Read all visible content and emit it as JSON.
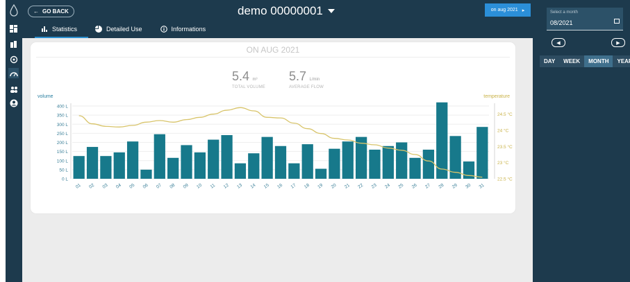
{
  "header": {
    "back_label": "GO BACK",
    "device_title": "demo 00000001",
    "date_pill": "on aug 2021"
  },
  "tabs": [
    {
      "label": "Statistics",
      "icon": "bar-chart-icon",
      "active": true
    },
    {
      "label": "Detailed Use",
      "icon": "pie-chart-icon",
      "active": false
    },
    {
      "label": "Informations",
      "icon": "info-icon",
      "active": false
    }
  ],
  "sidebar": {
    "icons": [
      "water-drop-logo",
      "dashboard-icon",
      "building-icon",
      "meter-icon",
      "gauge-icon",
      "users-icon",
      "account-icon"
    ]
  },
  "right_panel": {
    "month_label": "Select a month",
    "month_value": "08/2021",
    "periods": [
      "DAY",
      "WEEK",
      "MONTH",
      "YEAR"
    ],
    "active_period": "MONTH"
  },
  "card": {
    "title": "ON AUG 2021",
    "total_volume": {
      "value": "5.4",
      "unit": "m³",
      "label": "TOTAL VOLUME"
    },
    "average_flow": {
      "value": "5.7",
      "unit": "L/min",
      "label": "AVERAGE FLOW"
    }
  },
  "colors": {
    "sidebar": "#1d3a4d",
    "bar": "#17798b",
    "temperature_line": "#d8c46a",
    "accent": "#2b8fd9"
  },
  "chart_data": {
    "type": "bar",
    "categories": [
      "01",
      "02",
      "03",
      "04",
      "05",
      "06",
      "07",
      "08",
      "09",
      "10",
      "11",
      "12",
      "13",
      "14",
      "15",
      "16",
      "17",
      "18",
      "19",
      "20",
      "21",
      "22",
      "23",
      "24",
      "25",
      "26",
      "27",
      "28",
      "29",
      "30",
      "31"
    ],
    "series": [
      {
        "name": "volume",
        "type": "bar",
        "axis": "left",
        "unit": "L",
        "values": [
          125,
          175,
          125,
          145,
          205,
          50,
          245,
          115,
          185,
          145,
          215,
          240,
          85,
          140,
          230,
          180,
          85,
          190,
          55,
          165,
          205,
          230,
          160,
          180,
          200,
          115,
          160,
          420,
          235,
          95,
          285
        ]
      },
      {
        "name": "temperature",
        "type": "line",
        "axis": "right",
        "unit": "°C",
        "values": [
          24.45,
          24.2,
          24.12,
          24.1,
          24.15,
          24.25,
          24.3,
          24.25,
          24.33,
          24.4,
          24.5,
          24.62,
          24.7,
          24.6,
          24.4,
          24.38,
          24.22,
          24.05,
          23.9,
          23.75,
          23.7,
          23.6,
          23.55,
          23.45,
          23.38,
          23.25,
          23.05,
          22.8,
          22.7,
          22.6,
          22.55
        ]
      }
    ],
    "y_left": {
      "label": "volume",
      "ylim": [
        0,
        400
      ],
      "ticks": [
        "0 L",
        "50 L",
        "100 L",
        "150 L",
        "200 L",
        "250 L",
        "300 L",
        "350 L",
        "400 L"
      ]
    },
    "y_right": {
      "label": "temperature",
      "ylim": [
        22.5,
        24.75
      ],
      "ticks": [
        "22.5 °C",
        "23 °C",
        "23.5 °C",
        "24 °C",
        "24.5 °C"
      ]
    },
    "grid": true,
    "legend": "none"
  }
}
